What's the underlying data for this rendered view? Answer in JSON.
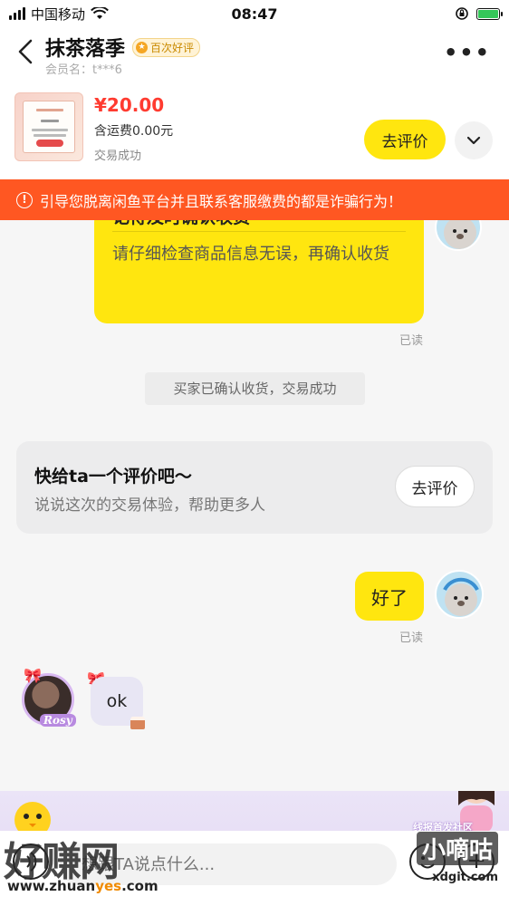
{
  "status_bar": {
    "carrier": "中国移动",
    "time": "08:47"
  },
  "header": {
    "title": "抹茶落季",
    "badge": "百次好评",
    "member": "会员名：t***6",
    "back_glyph": "‹",
    "more_glyph": "•••"
  },
  "product": {
    "price": "¥20.00",
    "shipping": "含运费0.00元",
    "status": "交易成功",
    "review_button": "去评价"
  },
  "warning": {
    "icon": "!",
    "text": "引导您脱离闲鱼平台并且联系客服缴费的都是诈骗行为！"
  },
  "chat": {
    "card_title": "记得及时确认收货",
    "card_body": "请仔细检查商品信息无误，再确认收货",
    "read_label": "已读",
    "system_message": "买家已确认收货，交易成功",
    "review_card": {
      "title": "快给ta一个评价吧～",
      "subtitle": "说说这次的交易体验，帮助更多人",
      "button": "去评价"
    },
    "my_message": "好了",
    "my_read_label": "已读",
    "their_message": "ok",
    "their_avatar_tag": "Rosy"
  },
  "input": {
    "placeholder": "想跟TA说点什么...",
    "plus_glyph": "+"
  },
  "promo": {
    "label": "线报首发社区"
  },
  "watermark": {
    "main": "好赚网",
    "url_prefix": "www.zhuan",
    "url_highlight": "yes",
    "url_suffix": ".com",
    "right_main": "小嘀咕",
    "right_url": "xdgit.com"
  },
  "colors": {
    "accent_yellow": "#ffe60f",
    "warning_orange": "#ff5722",
    "price_red": "#ff3b30"
  }
}
